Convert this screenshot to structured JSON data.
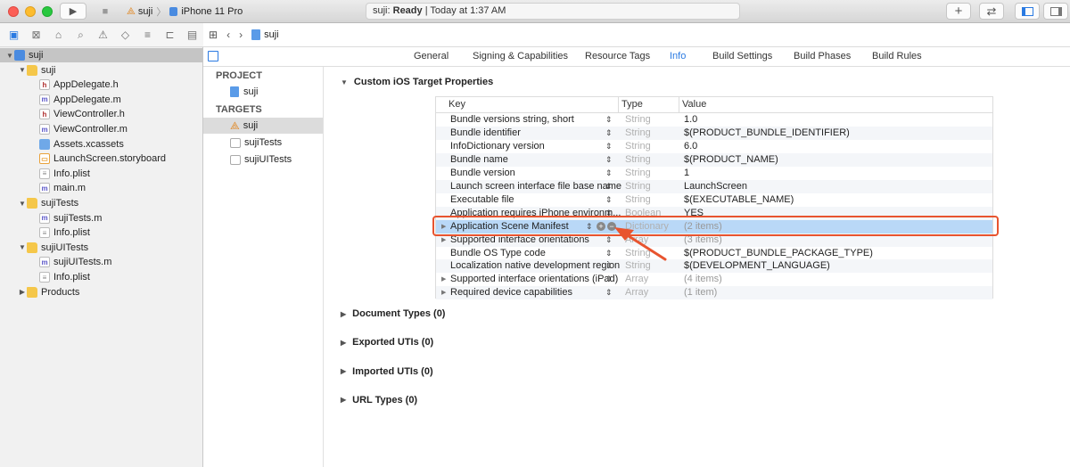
{
  "toolbar": {
    "scheme": "suji",
    "device": "iPhone 11 Pro",
    "status_app": "suji: ",
    "status_state": "Ready",
    "status_time": " | Today at 1:37 AM",
    "add_label": "+",
    "swap_label": "⇄",
    "run_label": "▶",
    "stop_label": "■"
  },
  "navigator": {
    "rows": [
      {
        "label": "suji",
        "indent": 0,
        "icon": "project",
        "disclosure": "▼",
        "selected": true
      },
      {
        "label": "suji",
        "indent": 1,
        "icon": "folder",
        "disclosure": "▼"
      },
      {
        "label": "AppDelegate.h",
        "indent": 2,
        "icon": "h"
      },
      {
        "label": "AppDelegate.m",
        "indent": 2,
        "icon": "m"
      },
      {
        "label": "ViewController.h",
        "indent": 2,
        "icon": "h"
      },
      {
        "label": "ViewController.m",
        "indent": 2,
        "icon": "m"
      },
      {
        "label": "Assets.xcassets",
        "indent": 2,
        "icon": "assets"
      },
      {
        "label": "LaunchScreen.storyboard",
        "indent": 2,
        "icon": "storyboard"
      },
      {
        "label": "Info.plist",
        "indent": 2,
        "icon": "plist"
      },
      {
        "label": "main.m",
        "indent": 2,
        "icon": "m"
      },
      {
        "label": "sujiTests",
        "indent": 1,
        "icon": "folder",
        "disclosure": "▼"
      },
      {
        "label": "sujiTests.m",
        "indent": 2,
        "icon": "m"
      },
      {
        "label": "Info.plist",
        "indent": 2,
        "icon": "plist"
      },
      {
        "label": "sujiUITests",
        "indent": 1,
        "icon": "folder",
        "disclosure": "▼"
      },
      {
        "label": "sujiUITests.m",
        "indent": 2,
        "icon": "m"
      },
      {
        "label": "Info.plist",
        "indent": 2,
        "icon": "plist"
      },
      {
        "label": "Products",
        "indent": 1,
        "icon": "folder",
        "disclosure": "▶"
      }
    ]
  },
  "jumpbar": {
    "file": "suji"
  },
  "tabs": [
    "General",
    "Signing & Capabilities",
    "Resource Tags",
    "Info",
    "Build Settings",
    "Build Phases",
    "Build Rules"
  ],
  "active_tab": "Info",
  "project_panel": {
    "project_header": "PROJECT",
    "project_item": "suji",
    "targets_header": "TARGETS",
    "targets": [
      "suji",
      "sujiTests",
      "sujiUITests"
    ]
  },
  "custom_section": "Custom iOS Target Properties",
  "table": {
    "headers": {
      "key": "Key",
      "type": "Type",
      "value": "Value"
    },
    "rows": [
      {
        "key": "Bundle versions string, short",
        "type": "String",
        "value": "1.0"
      },
      {
        "key": "Bundle identifier",
        "type": "String",
        "value": "$(PRODUCT_BUNDLE_IDENTIFIER)"
      },
      {
        "key": "InfoDictionary version",
        "type": "String",
        "value": "6.0"
      },
      {
        "key": "Bundle name",
        "type": "String",
        "value": "$(PRODUCT_NAME)"
      },
      {
        "key": "Bundle version",
        "type": "String",
        "value": "1"
      },
      {
        "key": "Launch screen interface file base name",
        "type": "String",
        "value": "LaunchScreen"
      },
      {
        "key": "Executable file",
        "type": "String",
        "value": "$(EXECUTABLE_NAME)"
      },
      {
        "key": "Application requires iPhone environm...",
        "type": "Boolean",
        "value": "YES"
      },
      {
        "key": "Application Scene Manifest",
        "type": "Dictionary",
        "value": "(2 items)",
        "expandable": true,
        "selected": true
      },
      {
        "key": "Supported interface orientations",
        "type": "Array",
        "value": "(3 items)",
        "expandable": true
      },
      {
        "key": "Bundle OS Type code",
        "type": "String",
        "value": "$(PRODUCT_BUNDLE_PACKAGE_TYPE)"
      },
      {
        "key": "Localization native development region",
        "type": "String",
        "value": "$(DEVELOPMENT_LANGUAGE)"
      },
      {
        "key": "Supported interface orientations (iPad)",
        "type": "Array",
        "value": "(4 items)",
        "expandable": true
      },
      {
        "key": "Required device capabilities",
        "type": "Array",
        "value": "(1 item)",
        "expandable": true
      }
    ]
  },
  "sections": [
    "Document Types (0)",
    "Exported UTIs (0)",
    "Imported UTIs (0)",
    "URL Types (0)"
  ],
  "colors": {
    "accent": "#2a7ae2",
    "highlight_box": "#e8542f",
    "selection": "#b9d8f7"
  }
}
